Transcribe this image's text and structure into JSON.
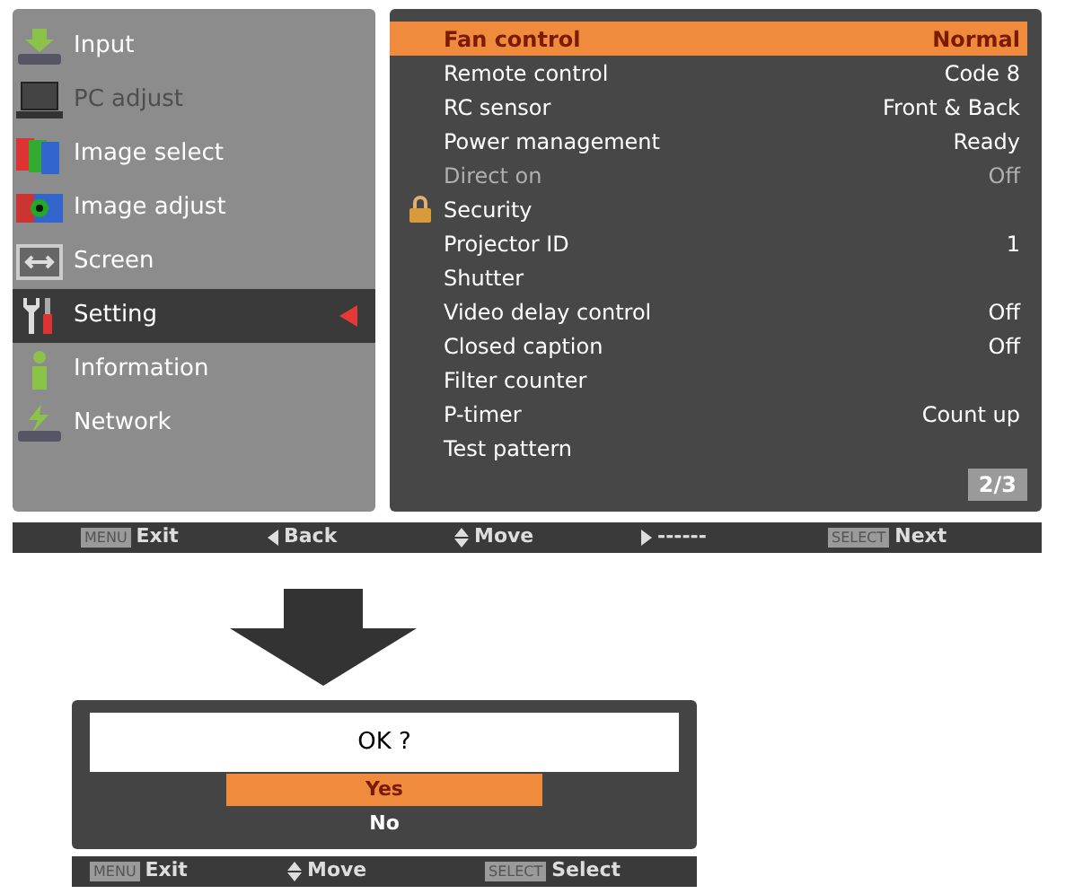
{
  "sidebar": {
    "items": [
      {
        "label": "Input",
        "selected": false,
        "disabled": false
      },
      {
        "label": "PC adjust",
        "selected": false,
        "disabled": true
      },
      {
        "label": "Image select",
        "selected": false,
        "disabled": false
      },
      {
        "label": "Image adjust",
        "selected": false,
        "disabled": false
      },
      {
        "label": "Screen",
        "selected": false,
        "disabled": false
      },
      {
        "label": "Setting",
        "selected": true,
        "disabled": false
      },
      {
        "label": "Information",
        "selected": false,
        "disabled": false
      },
      {
        "label": "Network",
        "selected": false,
        "disabled": false
      }
    ]
  },
  "settings": {
    "rows": [
      {
        "label": "Fan control",
        "value": "Normal",
        "selected": true,
        "disabled": false,
        "locked": false
      },
      {
        "label": "Remote control",
        "value": "Code 8",
        "selected": false,
        "disabled": false,
        "locked": false
      },
      {
        "label": "RC sensor",
        "value": "Front & Back",
        "selected": false,
        "disabled": false,
        "locked": false
      },
      {
        "label": "Power management",
        "value": "Ready",
        "selected": false,
        "disabled": false,
        "locked": false
      },
      {
        "label": "Direct on",
        "value": "Off",
        "selected": false,
        "disabled": true,
        "locked": false
      },
      {
        "label": "Security",
        "selected": false,
        "disabled": false,
        "locked": true
      },
      {
        "label": "Projector ID",
        "value": "1",
        "selected": false,
        "disabled": false,
        "locked": false
      },
      {
        "label": "Shutter",
        "selected": false,
        "disabled": false,
        "locked": false
      },
      {
        "label": "Video delay control",
        "value": "Off",
        "selected": false,
        "disabled": false,
        "locked": false
      },
      {
        "label": "Closed caption",
        "value": "Off",
        "selected": false,
        "disabled": false,
        "locked": false
      },
      {
        "label": "Filter counter",
        "selected": false,
        "disabled": false,
        "locked": false
      },
      {
        "label": "P-timer",
        "value": "Count up",
        "selected": false,
        "disabled": false,
        "locked": false
      },
      {
        "label": "Test pattern",
        "selected": false,
        "disabled": false,
        "locked": false
      }
    ],
    "page": "2/3"
  },
  "guide_bar": [
    {
      "kind": "key",
      "key": "MENU",
      "label": "Exit"
    },
    {
      "kind": "left",
      "label": "Back"
    },
    {
      "kind": "updown",
      "label": "Move"
    },
    {
      "kind": "right",
      "label": "------"
    },
    {
      "kind": "key",
      "key": "SELECT",
      "label": "Next"
    }
  ],
  "dialog": {
    "message": "OK ?",
    "options": [
      {
        "label": "Yes",
        "selected": true
      },
      {
        "label": "No",
        "selected": false
      }
    ]
  },
  "dialog_guide_bar": [
    {
      "kind": "key",
      "key": "MENU",
      "label": "Exit"
    },
    {
      "kind": "updown",
      "label": "Move"
    },
    {
      "kind": "key",
      "key": "SELECT",
      "label": "Select"
    }
  ]
}
